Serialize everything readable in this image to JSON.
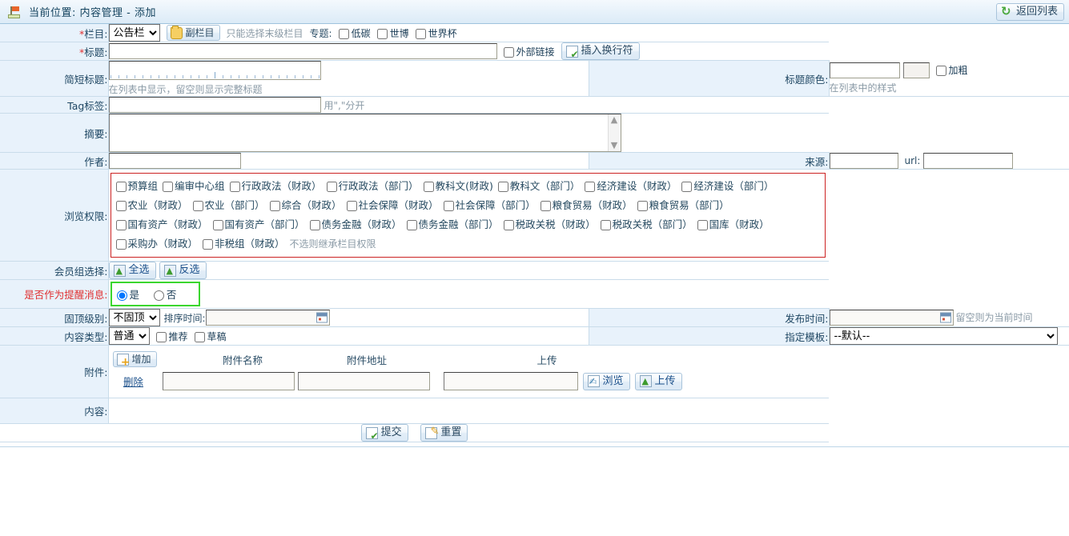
{
  "topbar": {
    "breadcrumb": "当前位置: 内容管理 - 添加",
    "return_button": "返回列表",
    "flag_icon": "flag-icon",
    "refresh_icon": "refresh-icon"
  },
  "form": {
    "column": {
      "label": "栏目:",
      "required": "*",
      "select_value": "公告栏",
      "options": [
        "公告栏"
      ],
      "sub_column_button": "副栏目",
      "hint": "只能选择末级栏目",
      "topic_label": "专题:",
      "topics": [
        "低碳",
        "世博",
        "世界杯"
      ]
    },
    "title": {
      "label": "标题:",
      "required": "*",
      "value": "",
      "external_link_label": "外部链接",
      "insert_break_button": "插入换行符"
    },
    "short_title": {
      "label": "简短标题:",
      "value": "",
      "hint": "在列表中显示，留空则显示完整标题",
      "color_label": "标题颜色:",
      "color_value": "",
      "color_swatch_value": "",
      "bold_label": "加粗",
      "color_hint": "在列表中的样式"
    },
    "tag": {
      "label": "Tag标签:",
      "value": "",
      "hint": "用\",\"分开"
    },
    "summary": {
      "label": "摘要:",
      "value": ""
    },
    "author": {
      "label": "作者:",
      "value": "",
      "source_label": "来源:",
      "source_value": "",
      "url_label": "url:",
      "url_value": ""
    },
    "permissions": {
      "label": "浏览权限:",
      "hint": "不选则继承栏目权限",
      "items": [
        "预算组",
        "编审中心组",
        "行政政法（财政）",
        "行政政法（部门）",
        "教科文(财政)",
        "教科文（部门）",
        "经济建设（财政）",
        "经济建设（部门）",
        "农业（财政）",
        "农业（部门）",
        "综合（财政）",
        "社会保障（财政）",
        "社会保障（部门）",
        "粮食贸易（财政）",
        "粮食贸易（部门）",
        "国有资产（财政）",
        "国有资产（部门）",
        "债务金融（财政）",
        "债务金融（部门）",
        "税政关税（财政）",
        "税政关税（部门）",
        "国库（财政）",
        "采购办（财政）",
        "非税组（财政）"
      ]
    },
    "member_group": {
      "label": "会员组选择:",
      "select_all_button": "全选",
      "invert_button": "反选"
    },
    "remind": {
      "label": "是否作为提醒消息:",
      "yes": "是",
      "no": "否",
      "selected": "是"
    },
    "top_level": {
      "label": "固顶级别:",
      "select_value": "不固顶",
      "options": [
        "不固顶"
      ],
      "sort_time_label": "排序时间:",
      "sort_time_value": "",
      "publish_label": "发布时间:",
      "publish_value": "",
      "publish_hint": "留空则为当前时间"
    },
    "content_type": {
      "label": "内容类型:",
      "select_value": "普通",
      "options": [
        "普通"
      ],
      "recommend_label": "推荐",
      "draft_label": "草稿",
      "template_label": "指定模板:",
      "template_value": "--默认--",
      "template_options": [
        "--默认--"
      ]
    },
    "attachment": {
      "label": "附件:",
      "add_button": "增加",
      "col_name": "附件名称",
      "col_address": "附件地址",
      "col_upload": "上传",
      "delete_link": "删除",
      "name_value": "",
      "address_value": "",
      "file_value": "",
      "browse_button": "浏览",
      "upload_button": "上传"
    },
    "content": {
      "label": "内容:"
    }
  },
  "footer": {
    "submit_button": "提交",
    "reset_button": "重置"
  }
}
